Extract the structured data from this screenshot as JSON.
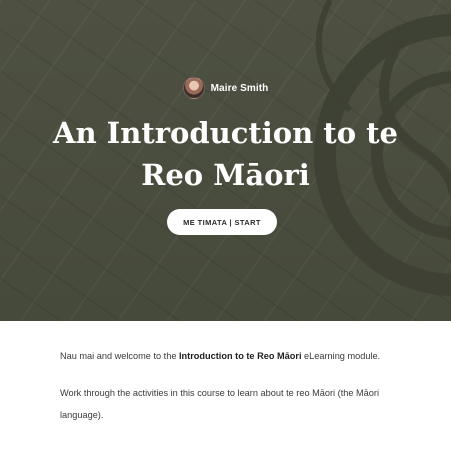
{
  "hero": {
    "author_name": "Maire Smith",
    "title": "An Introduction to te Reo Māori",
    "start_button_label": "ME TIMATA | START",
    "background_color": "#4b4e3f"
  },
  "content": {
    "para1_prefix": "Nau mai and welcome to the ",
    "para1_bold": "Introduction to te Reo Māori",
    "para1_suffix": " eLearning module.",
    "para2": "Work through the activities in this course to learn about te reo Māori (the Māori language)."
  },
  "icons": {
    "avatar": "author-avatar",
    "decoration": "koru-decoration-icon"
  }
}
